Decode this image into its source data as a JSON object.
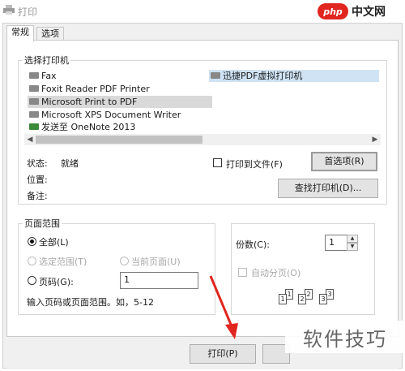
{
  "window": {
    "title": "打印"
  },
  "watermark_top": {
    "logo": "php",
    "text": "中文网"
  },
  "watermark_bottom": {
    "text": "软件技巧"
  },
  "tabs": [
    {
      "label": "常规",
      "active": true
    },
    {
      "label": "选项",
      "active": false
    }
  ],
  "select_printer": {
    "group_label": "选择打印机",
    "printers": [
      {
        "name": "Fax",
        "icon": "printer-icon"
      },
      {
        "name": "Foxit Reader PDF Printer",
        "icon": "printer-icon"
      },
      {
        "name": "Microsoft Print to PDF",
        "icon": "printer-icon",
        "selected": true
      },
      {
        "name": "Microsoft XPS Document Writer",
        "icon": "printer-icon"
      },
      {
        "name": "发送至 OneNote 2013",
        "icon": "onenote-printer-icon"
      },
      {
        "name": "迅捷PDF虚拟打印机",
        "icon": "printer-icon",
        "highlighted": true
      }
    ],
    "status_label": "状态:",
    "status_value": "就绪",
    "location_label": "位置:",
    "comment_label": "备注:",
    "print_to_file_label": "打印到文件(F)",
    "print_to_file_checked": false,
    "preferences_button": "首选项(R)",
    "find_printer_button": "查找打印机(D)..."
  },
  "page_range": {
    "group_label": "页面范围",
    "all_label": "全部(L)",
    "selection_label": "选定范围(T)",
    "current_page_label": "当前页面(U)",
    "pages_label": "页码(G):",
    "pages_value": "1",
    "hint": "输入页码或页面范围。如，5-12",
    "selected_option": "all"
  },
  "copies": {
    "label": "份数(C):",
    "value": "1",
    "collate_label": "自动分页(O)",
    "collate_checked": false,
    "collate_pages": [
      "1",
      "1",
      "2",
      "2",
      "3",
      "3"
    ]
  },
  "actions": {
    "print_button": "打印(P)"
  },
  "colors": {
    "dialog_bg": "#f0f0f0",
    "selected_row": "#d9d9d9",
    "highlighted_row": "#cfe3f5",
    "arrow": "#e0261f",
    "php_logo": "#e0261f"
  }
}
